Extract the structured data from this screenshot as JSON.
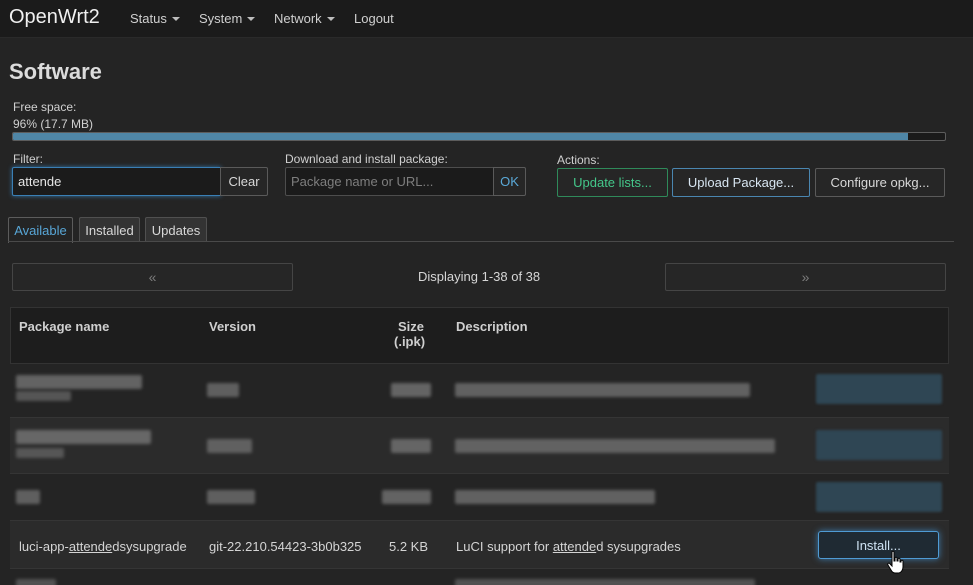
{
  "nav": {
    "brand": "OpenWrt2",
    "items": [
      {
        "label": "Status",
        "dropdown": true
      },
      {
        "label": "System",
        "dropdown": true
      },
      {
        "label": "Network",
        "dropdown": true
      },
      {
        "label": "Logout",
        "dropdown": false
      }
    ]
  },
  "page": {
    "title": "Software"
  },
  "free_space": {
    "label": "Free space:",
    "value": "96% (17.7 MB)",
    "percent": 96
  },
  "filter": {
    "label": "Filter:",
    "value": "attende",
    "clear_label": "Clear"
  },
  "download": {
    "label": "Download and install package:",
    "placeholder": "Package name or URL...",
    "ok_label": "OK"
  },
  "actions": {
    "label": "Actions:",
    "update_lists": "Update lists...",
    "upload_package": "Upload Package...",
    "configure_opkg": "Configure opkg..."
  },
  "tabs": [
    {
      "label": "Available",
      "active": true
    },
    {
      "label": "Installed",
      "active": false
    },
    {
      "label": "Updates",
      "active": false
    }
  ],
  "pager": {
    "prev": "«",
    "next": "»",
    "text": "Displaying 1-38 of 38"
  },
  "table": {
    "headers": {
      "name": "Package name",
      "version": "Version",
      "size_line1": "Size",
      "size_line2": "(.ipk)",
      "description": "Description"
    },
    "visible_row": {
      "name_prefix": "luci-app-",
      "name_match": "attende",
      "name_suffix": "dsysupgrade",
      "version": "git-22.210.54423-3b0b325",
      "size": "5.2 KB",
      "desc_prefix": "LuCI support for ",
      "desc_match": "attende",
      "desc_suffix": "d sysupgrades",
      "install_label": "Install..."
    }
  },
  "colors": {
    "accent": "#4f86a6",
    "green": "#44c78a",
    "focus_blue": "#4f9bd4"
  }
}
